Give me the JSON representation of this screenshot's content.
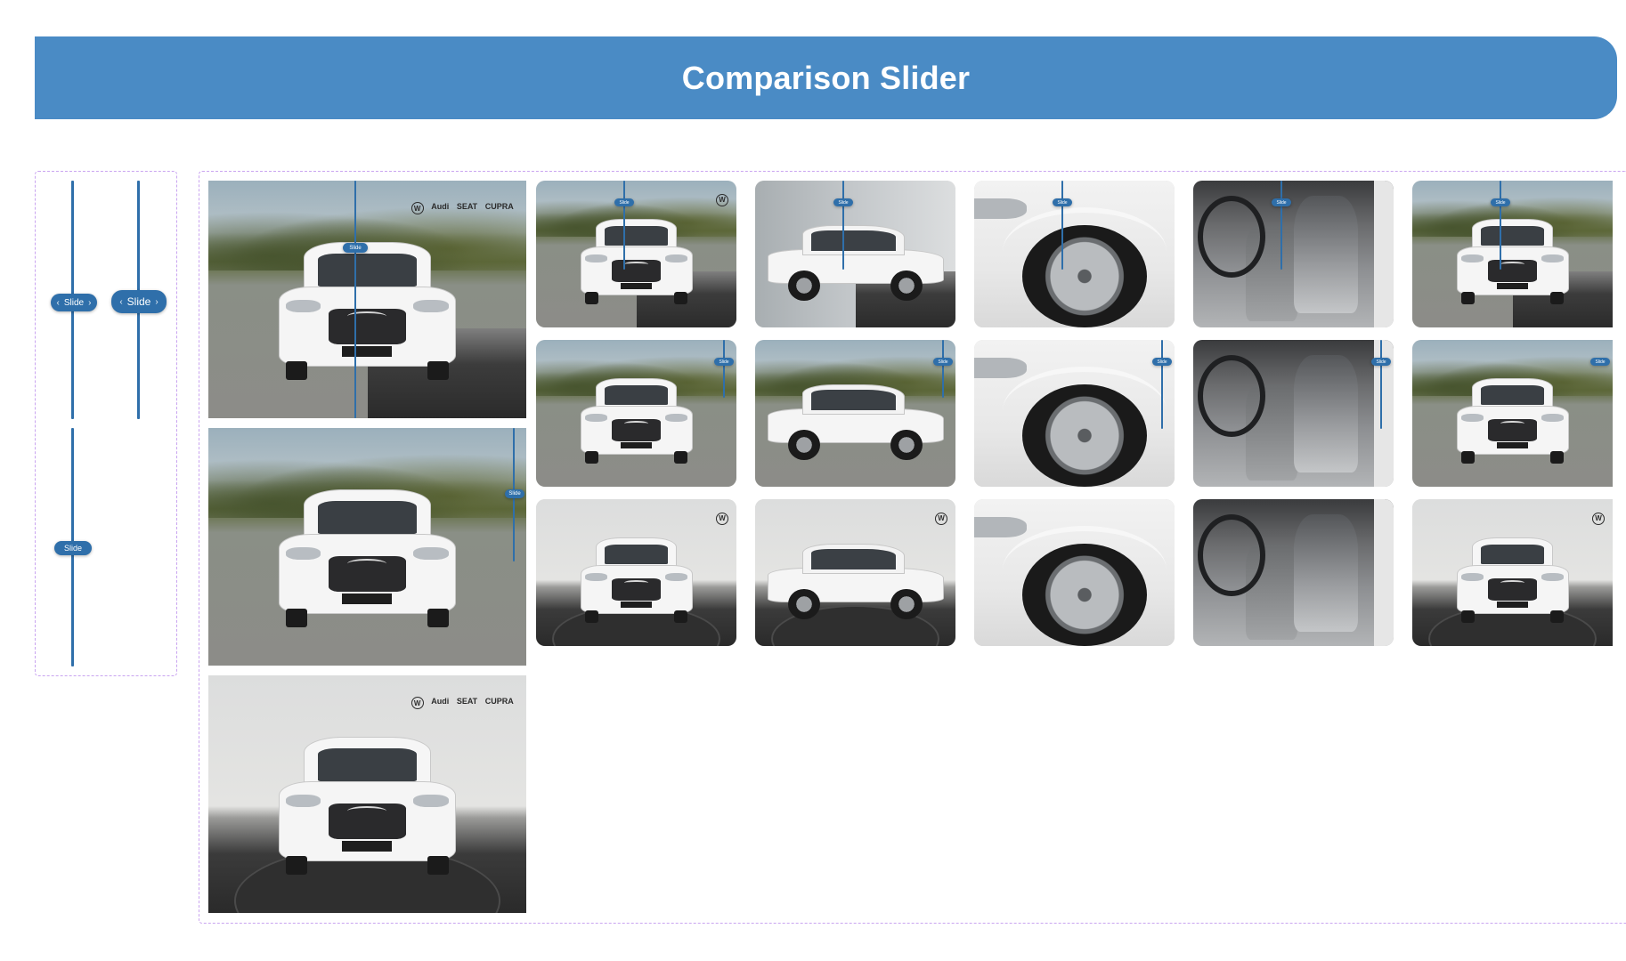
{
  "header": {
    "title": "Comparison Slider"
  },
  "slider": {
    "handle_label": "Slide"
  },
  "brands": {
    "vw": "VW",
    "audi": "Audi",
    "seat": "SEAT",
    "cupra": "CUPRA"
  }
}
